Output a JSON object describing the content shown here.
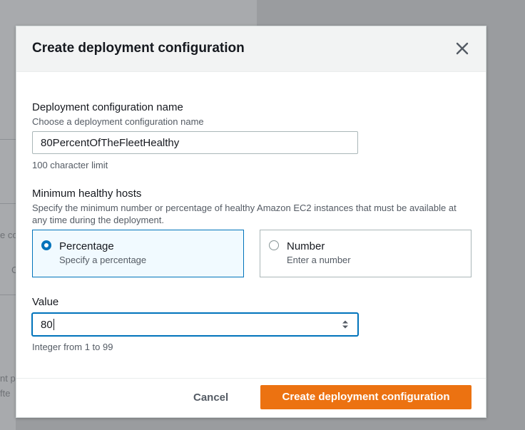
{
  "background": {
    "fragments": [
      "e co",
      "C",
      "nt p",
      "fte"
    ]
  },
  "modal": {
    "title": "Create deployment configuration",
    "close_icon": "close-icon",
    "name_field": {
      "label": "Deployment configuration name",
      "description": "Choose a deployment configuration name",
      "value": "80PercentOfTheFleetHealthy",
      "constraint": "100 character limit"
    },
    "min_healthy_hosts": {
      "label": "Minimum healthy hosts",
      "description": "Specify the minimum number or percentage of healthy Amazon EC2 instances that must be available at any time during the deployment.",
      "options": [
        {
          "title": "Percentage",
          "subtitle": "Specify a percentage",
          "selected": true
        },
        {
          "title": "Number",
          "subtitle": "Enter a number",
          "selected": false
        }
      ]
    },
    "value_field": {
      "label": "Value",
      "value": "80",
      "constraint": "Integer from 1 to 99"
    },
    "footer": {
      "cancel_label": "Cancel",
      "submit_label": "Create deployment configuration"
    }
  },
  "colors": {
    "accent": "#0073bb",
    "primary_button": "#ec7211",
    "overlay": "#9a9c9f"
  }
}
